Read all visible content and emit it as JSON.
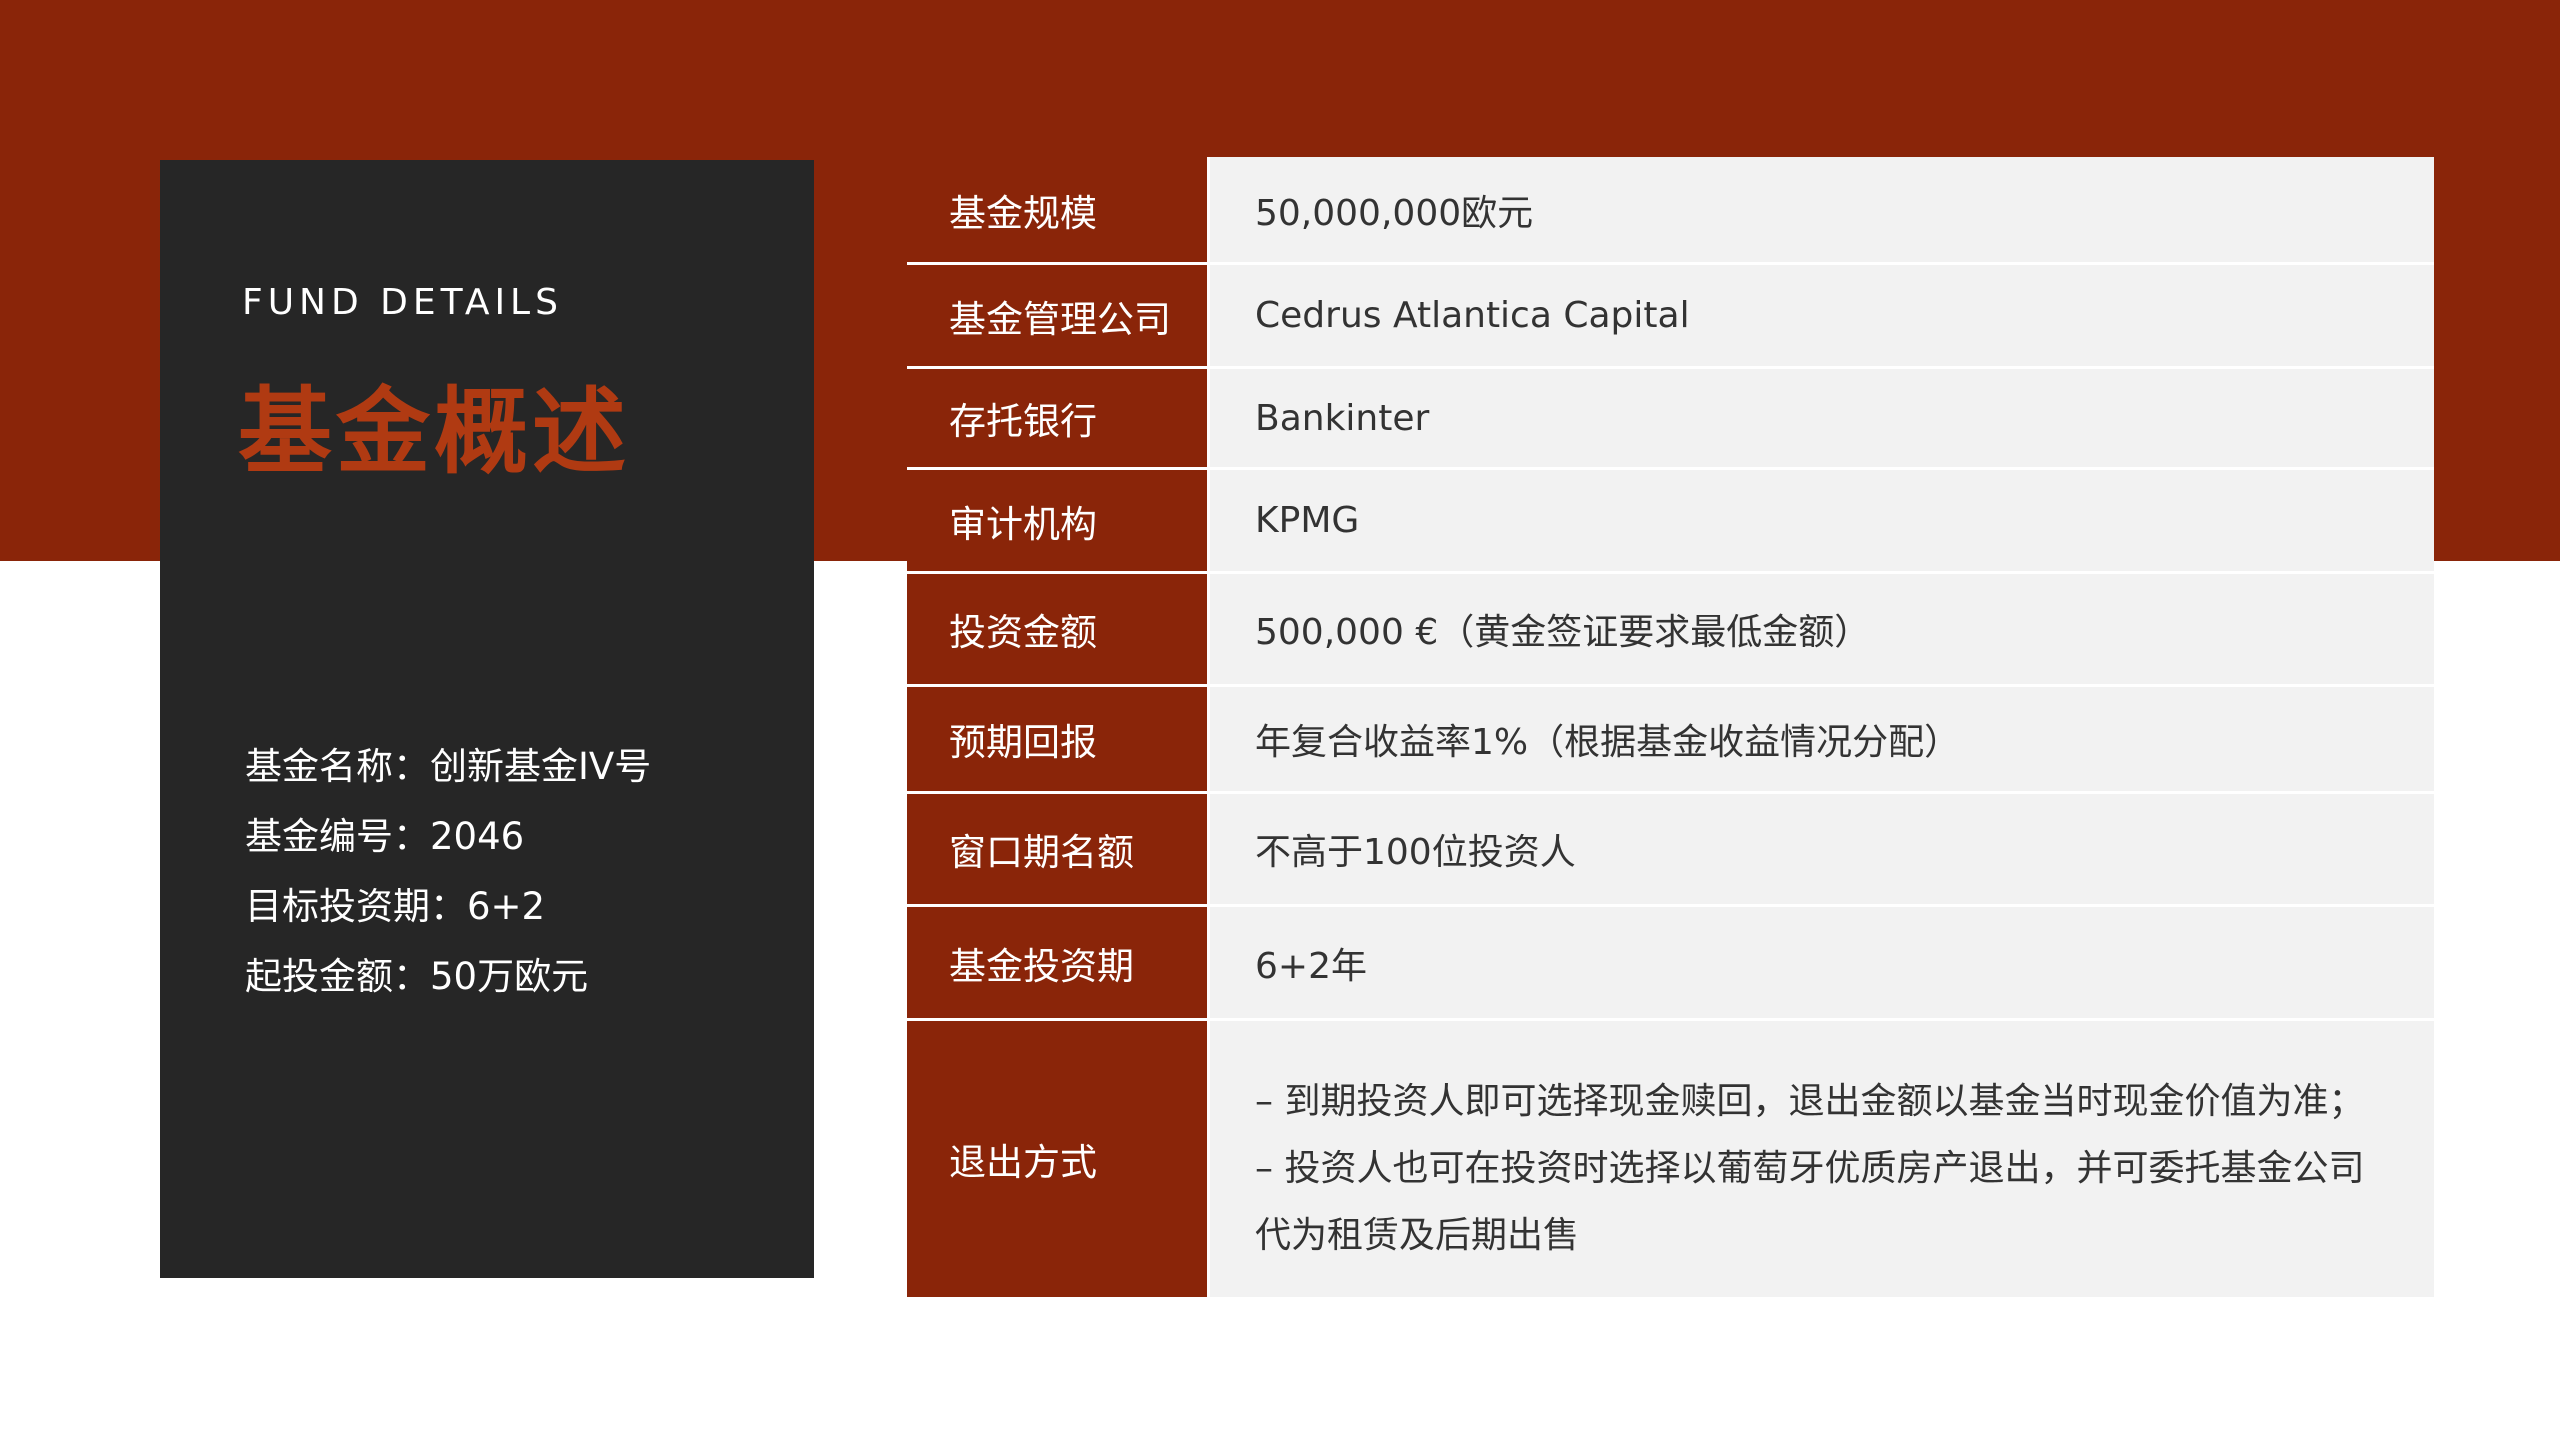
{
  "header": {
    "eyebrow": "FUND DETAILS",
    "title": "基金概述"
  },
  "summary": [
    "基金名称：创新基金IV号",
    "基金编号：2046",
    "目标投资期：6+2",
    "起投金额：50万欧元"
  ],
  "details": [
    {
      "label": "基金规模",
      "value": "50,000,000欧元"
    },
    {
      "label": "基金管理公司",
      "value": "Cedrus Atlantica Capital"
    },
    {
      "label": "存托银行",
      "value": "Bankinter"
    },
    {
      "label": "审计机构",
      "value": "KPMG"
    },
    {
      "label": "投资金额",
      "value": "500,000 €（黄金签证要求最低金额）"
    },
    {
      "label": "预期回报",
      "value": "年复合收益率1%（根据基金收益情况分配）"
    },
    {
      "label": "窗口期名额",
      "value": "不高于100位投资人"
    },
    {
      "label": "基金投资期",
      "value": "6+2年"
    },
    {
      "label": "退出方式",
      "lines": [
        "– 到期投资人即可选择现金赎回，退出金额以基金当时现金价值为准；",
        "– 投资人也可在投资时选择以葡萄牙优质房产退出，并可委托基金公司",
        "代为租赁及后期出售"
      ]
    }
  ],
  "colors": {
    "brand_red": "#8a2509",
    "title_red": "#b03a12",
    "card_dark": "#262626",
    "cell_bg": "#f2f2f2"
  }
}
